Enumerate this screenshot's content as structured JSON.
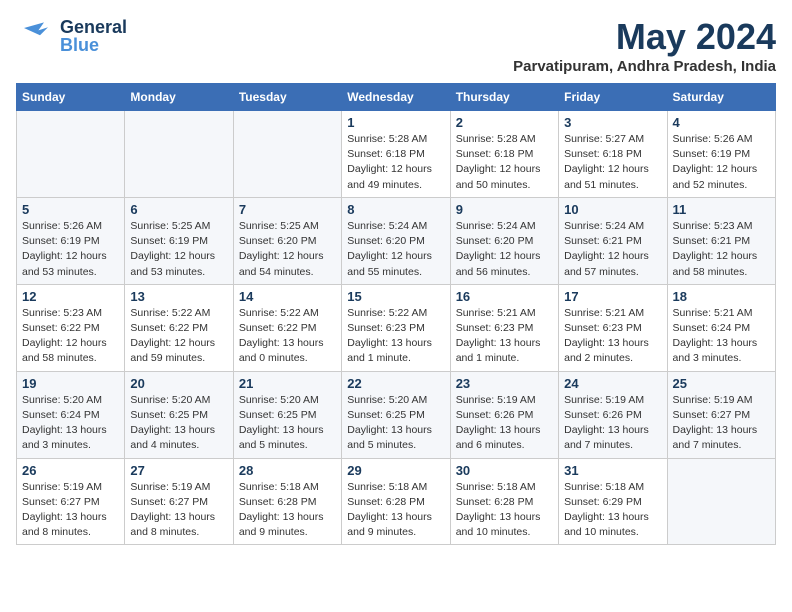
{
  "header": {
    "logo": {
      "general": "General",
      "blue": "Blue"
    },
    "title": "May 2024",
    "subtitle": "Parvatipuram, Andhra Pradesh, India"
  },
  "calendar": {
    "weekdays": [
      "Sunday",
      "Monday",
      "Tuesday",
      "Wednesday",
      "Thursday",
      "Friday",
      "Saturday"
    ],
    "weeks": [
      [
        {
          "day": "",
          "info": ""
        },
        {
          "day": "",
          "info": ""
        },
        {
          "day": "",
          "info": ""
        },
        {
          "day": "1",
          "info": "Sunrise: 5:28 AM\nSunset: 6:18 PM\nDaylight: 12 hours\nand 49 minutes."
        },
        {
          "day": "2",
          "info": "Sunrise: 5:28 AM\nSunset: 6:18 PM\nDaylight: 12 hours\nand 50 minutes."
        },
        {
          "day": "3",
          "info": "Sunrise: 5:27 AM\nSunset: 6:18 PM\nDaylight: 12 hours\nand 51 minutes."
        },
        {
          "day": "4",
          "info": "Sunrise: 5:26 AM\nSunset: 6:19 PM\nDaylight: 12 hours\nand 52 minutes."
        }
      ],
      [
        {
          "day": "5",
          "info": "Sunrise: 5:26 AM\nSunset: 6:19 PM\nDaylight: 12 hours\nand 53 minutes."
        },
        {
          "day": "6",
          "info": "Sunrise: 5:25 AM\nSunset: 6:19 PM\nDaylight: 12 hours\nand 53 minutes."
        },
        {
          "day": "7",
          "info": "Sunrise: 5:25 AM\nSunset: 6:20 PM\nDaylight: 12 hours\nand 54 minutes."
        },
        {
          "day": "8",
          "info": "Sunrise: 5:24 AM\nSunset: 6:20 PM\nDaylight: 12 hours\nand 55 minutes."
        },
        {
          "day": "9",
          "info": "Sunrise: 5:24 AM\nSunset: 6:20 PM\nDaylight: 12 hours\nand 56 minutes."
        },
        {
          "day": "10",
          "info": "Sunrise: 5:24 AM\nSunset: 6:21 PM\nDaylight: 12 hours\nand 57 minutes."
        },
        {
          "day": "11",
          "info": "Sunrise: 5:23 AM\nSunset: 6:21 PM\nDaylight: 12 hours\nand 58 minutes."
        }
      ],
      [
        {
          "day": "12",
          "info": "Sunrise: 5:23 AM\nSunset: 6:22 PM\nDaylight: 12 hours\nand 58 minutes."
        },
        {
          "day": "13",
          "info": "Sunrise: 5:22 AM\nSunset: 6:22 PM\nDaylight: 12 hours\nand 59 minutes."
        },
        {
          "day": "14",
          "info": "Sunrise: 5:22 AM\nSunset: 6:22 PM\nDaylight: 13 hours\nand 0 minutes."
        },
        {
          "day": "15",
          "info": "Sunrise: 5:22 AM\nSunset: 6:23 PM\nDaylight: 13 hours\nand 1 minute."
        },
        {
          "day": "16",
          "info": "Sunrise: 5:21 AM\nSunset: 6:23 PM\nDaylight: 13 hours\nand 1 minute."
        },
        {
          "day": "17",
          "info": "Sunrise: 5:21 AM\nSunset: 6:23 PM\nDaylight: 13 hours\nand 2 minutes."
        },
        {
          "day": "18",
          "info": "Sunrise: 5:21 AM\nSunset: 6:24 PM\nDaylight: 13 hours\nand 3 minutes."
        }
      ],
      [
        {
          "day": "19",
          "info": "Sunrise: 5:20 AM\nSunset: 6:24 PM\nDaylight: 13 hours\nand 3 minutes."
        },
        {
          "day": "20",
          "info": "Sunrise: 5:20 AM\nSunset: 6:25 PM\nDaylight: 13 hours\nand 4 minutes."
        },
        {
          "day": "21",
          "info": "Sunrise: 5:20 AM\nSunset: 6:25 PM\nDaylight: 13 hours\nand 5 minutes."
        },
        {
          "day": "22",
          "info": "Sunrise: 5:20 AM\nSunset: 6:25 PM\nDaylight: 13 hours\nand 5 minutes."
        },
        {
          "day": "23",
          "info": "Sunrise: 5:19 AM\nSunset: 6:26 PM\nDaylight: 13 hours\nand 6 minutes."
        },
        {
          "day": "24",
          "info": "Sunrise: 5:19 AM\nSunset: 6:26 PM\nDaylight: 13 hours\nand 7 minutes."
        },
        {
          "day": "25",
          "info": "Sunrise: 5:19 AM\nSunset: 6:27 PM\nDaylight: 13 hours\nand 7 minutes."
        }
      ],
      [
        {
          "day": "26",
          "info": "Sunrise: 5:19 AM\nSunset: 6:27 PM\nDaylight: 13 hours\nand 8 minutes."
        },
        {
          "day": "27",
          "info": "Sunrise: 5:19 AM\nSunset: 6:27 PM\nDaylight: 13 hours\nand 8 minutes."
        },
        {
          "day": "28",
          "info": "Sunrise: 5:18 AM\nSunset: 6:28 PM\nDaylight: 13 hours\nand 9 minutes."
        },
        {
          "day": "29",
          "info": "Sunrise: 5:18 AM\nSunset: 6:28 PM\nDaylight: 13 hours\nand 9 minutes."
        },
        {
          "day": "30",
          "info": "Sunrise: 5:18 AM\nSunset: 6:28 PM\nDaylight: 13 hours\nand 10 minutes."
        },
        {
          "day": "31",
          "info": "Sunrise: 5:18 AM\nSunset: 6:29 PM\nDaylight: 13 hours\nand 10 minutes."
        },
        {
          "day": "",
          "info": ""
        }
      ]
    ]
  }
}
